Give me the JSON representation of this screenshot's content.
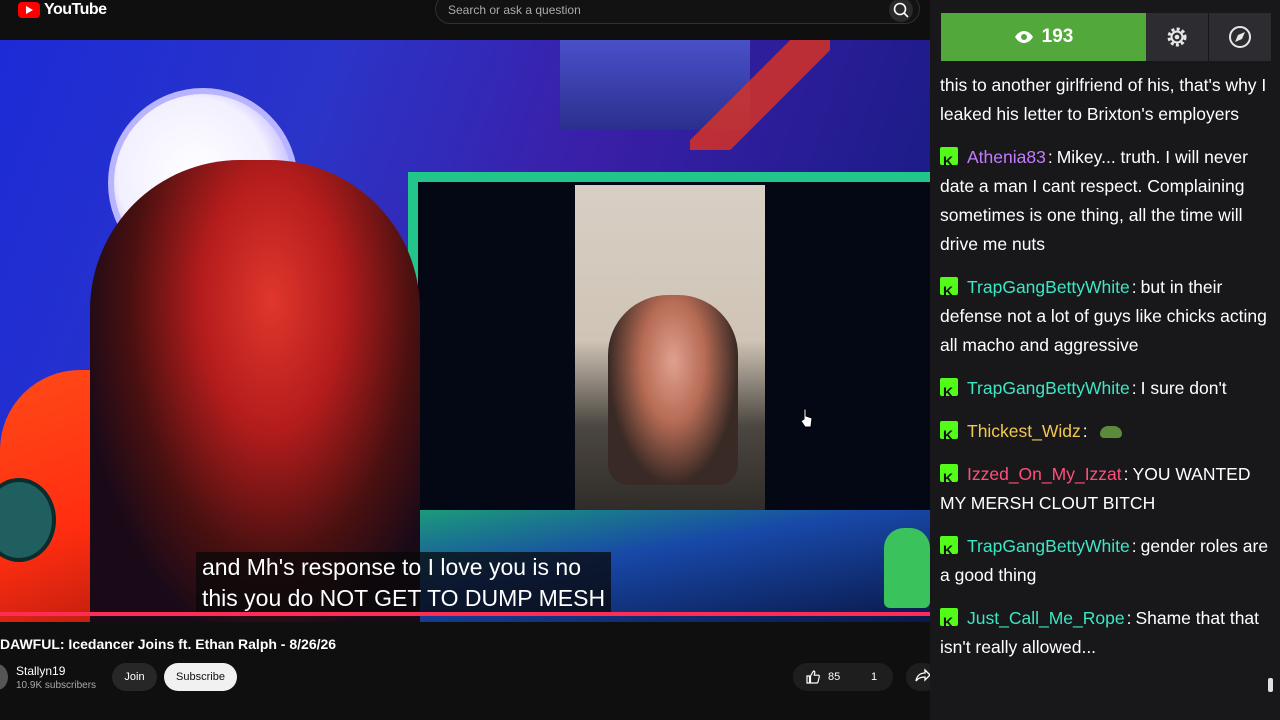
{
  "youtube": {
    "logo_text": "YouTube",
    "search_placeholder": "Search or ask a question",
    "video": {
      "caption_lines": [
        "and Mh's response to I love you is no",
        "this you do NOT GET TO DUMP MESH"
      ],
      "progress_color": "#ff2d55"
    },
    "title": "DAWFUL: Icedancer Joins ft. Ethan Ralph - 8/26/26",
    "channel": {
      "name": "Stallyn19",
      "subscribers": "10.9K subscribers"
    },
    "join_label": "Join",
    "subscribe_label": "Subscribe",
    "likes": "85",
    "dislikes": "1"
  },
  "chat": {
    "viewer_count": "193",
    "viewer_color": "#53a83b",
    "badge_color": "#53fc18",
    "messages": [
      {
        "user": "",
        "color": "#ffffff",
        "text": "this to another girlfriend of his, that's why I leaked his letter to Brixton's employers"
      },
      {
        "user": "Athenia83",
        "color": "#c47cff",
        "text": "Mikey... truth. I will never date a man I cant respect. Complaining sometimes is one thing, all the time will drive me nuts"
      },
      {
        "user": "TrapGangBettyWhite",
        "color": "#3ee6c4",
        "text": "but in their defense not a lot of guys like chicks acting all macho and aggressive"
      },
      {
        "user": "TrapGangBettyWhite",
        "color": "#3ee6c4",
        "text": "I sure don't"
      },
      {
        "user": "Thickest_Widz",
        "color": "#f2c94c",
        "text": ""
      },
      {
        "user": "Izzed_On_My_Izzat",
        "color": "#ff4f7a",
        "text": "YOU WANTED MY MERSH CLOUT BITCH"
      },
      {
        "user": "TrapGangBettyWhite",
        "color": "#3ee6c4",
        "text": "gender roles are a good thing"
      },
      {
        "user": "Just_Call_Me_Rope",
        "color": "#3ee6c4",
        "text": "Shame that that isn't really allowed..."
      }
    ]
  }
}
